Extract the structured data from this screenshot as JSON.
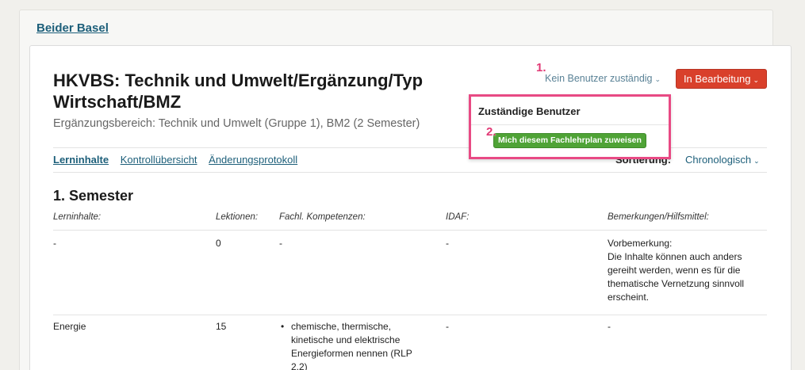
{
  "breadcrumb": "Beider Basel",
  "header": {
    "title": "HKVBS: Technik und Umwelt/Ergänzung/Typ Wirtschaft/BMZ",
    "subtitle": "Ergänzungsbereich: Technik und Umwelt (Gruppe 1), BM2 (2 Semester)",
    "assignee_toggle": "Kein Benutzer zuständig",
    "status_button": "In Bearbeitung"
  },
  "markers": {
    "step1": "1.",
    "step2": "2."
  },
  "dropdown": {
    "title": "Zuständige Benutzer",
    "assign_button": "Mich diesem Fachlehrplan zuweisen"
  },
  "tabs": [
    {
      "label": "Lerninhalte",
      "active": true
    },
    {
      "label": "Kontrollübersicht",
      "active": false
    },
    {
      "label": "Änderungsprotokoll",
      "active": false
    }
  ],
  "sort": {
    "label": "Sortierung:",
    "value": "Chronologisch"
  },
  "semester": {
    "title": "1. Semester",
    "columns": [
      "Lerninhalte:",
      "Lektionen:",
      "Fachl. Kompetenzen:",
      "IDAF:",
      "Bemerkungen/Hilfsmittel:"
    ],
    "rows": [
      {
        "content": "-",
        "lessons": "0",
        "competencies": "-",
        "idaf": "-",
        "remarks_title": "Vorbemerkung:",
        "remarks_text": "Die Inhalte können auch anders gereiht werden, wenn es für die thematische Vernetzung sinnvoll erscheint."
      },
      {
        "content": "Energie",
        "lessons": "15",
        "competencies_list": [
          "chemische, thermische, kinetische und elektrische Energieformen nennen (RLP 2.2)"
        ],
        "idaf": "-",
        "remarks": "-"
      }
    ]
  },
  "colors": {
    "accent_link": "#1d5f7a",
    "status_red": "#d9402b",
    "assign_green": "#4fa336",
    "highlight_pink": "#e84a84"
  }
}
